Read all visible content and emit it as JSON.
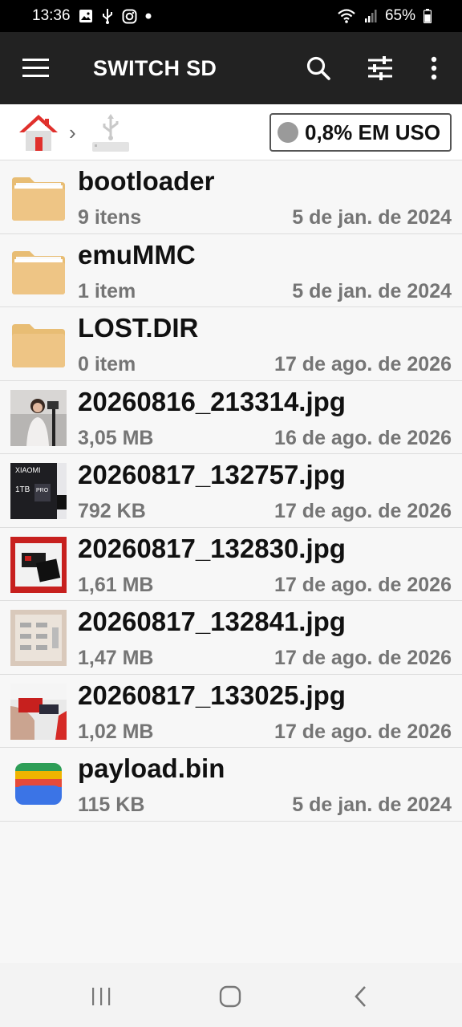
{
  "status_bar": {
    "time": "13:36",
    "battery": "65%"
  },
  "app_bar": {
    "title": "SWITCH SD"
  },
  "path": {
    "usage": "0,8% EM USO"
  },
  "files": [
    {
      "name": "bootloader",
      "meta": "9 itens",
      "date": "5 de jan. de 2024",
      "icon": "folder-icon",
      "kind": "folder-docs"
    },
    {
      "name": "emuMMC",
      "meta": "1 item",
      "date": "5 de jan. de 2024",
      "icon": "folder-icon",
      "kind": "folder-docs"
    },
    {
      "name": "LOST.DIR",
      "meta": "0 item",
      "date": "17 de ago. de 2026",
      "icon": "folder-icon",
      "kind": "folder"
    },
    {
      "name": "20260816_213314.jpg",
      "meta": "3,05 MB",
      "date": "16 de ago. de 2026",
      "icon": "image-thumbnail",
      "kind": "img1"
    },
    {
      "name": "20260817_132757.jpg",
      "meta": "792 KB",
      "date": "17 de ago. de 2026",
      "icon": "image-thumbnail",
      "kind": "img2"
    },
    {
      "name": "20260817_132830.jpg",
      "meta": "1,61 MB",
      "date": "17 de ago. de 2026",
      "icon": "image-thumbnail",
      "kind": "img3"
    },
    {
      "name": "20260817_132841.jpg",
      "meta": "1,47 MB",
      "date": "17 de ago. de 2026",
      "icon": "image-thumbnail",
      "kind": "img4"
    },
    {
      "name": "20260817_133025.jpg",
      "meta": "1,02 MB",
      "date": "17 de ago. de 2026",
      "icon": "image-thumbnail",
      "kind": "img5"
    },
    {
      "name": "payload.bin",
      "meta": "115 KB",
      "date": "5 de jan. de 2024",
      "icon": "wallet-app-icon",
      "kind": "wallet"
    }
  ],
  "colors": {
    "app_bar": "#222222",
    "folder": "#e8bd74",
    "secondary_text": "#757575"
  }
}
